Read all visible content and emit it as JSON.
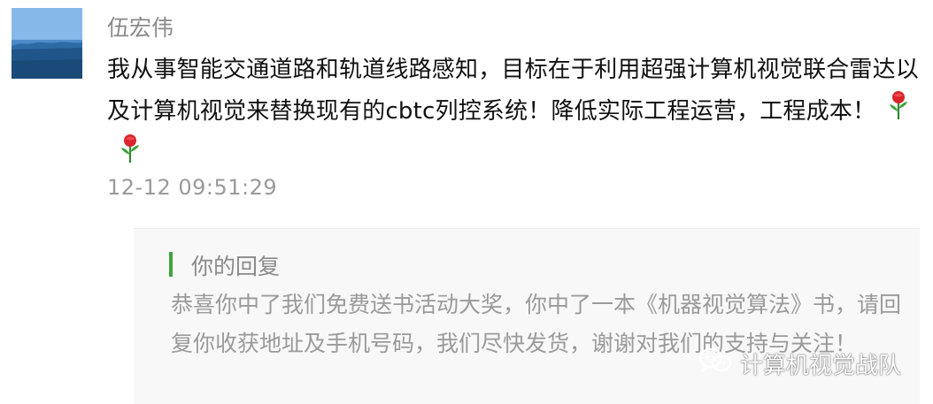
{
  "comment": {
    "author": "伍宏伟",
    "text": "我从事智能交通道路和轨道线路感知，目标在于利用超强计算机视觉联合雷达以及计算机视觉来替换现有的cbtc列控系统！降低实际工程运营，工程成本！",
    "emoji_name": "rose-emoji",
    "emoji_count": 2,
    "timestamp": "12-12 09:51:29"
  },
  "reply": {
    "title": "你的回复",
    "text": "恭喜你中了我们免费送书活动大奖，你中了一本《机器视觉算法》书，请回复你收获地址及手机号码，我们尽快发货，谢谢对我们的支持与关注！"
  },
  "watermark": {
    "icon": "wechat-icon",
    "text": "计算机视觉战队"
  },
  "colors": {
    "reply_accent": "#3fa33f",
    "reply_background": "#f8f8f8",
    "secondary_text": "#9a9a9a"
  }
}
